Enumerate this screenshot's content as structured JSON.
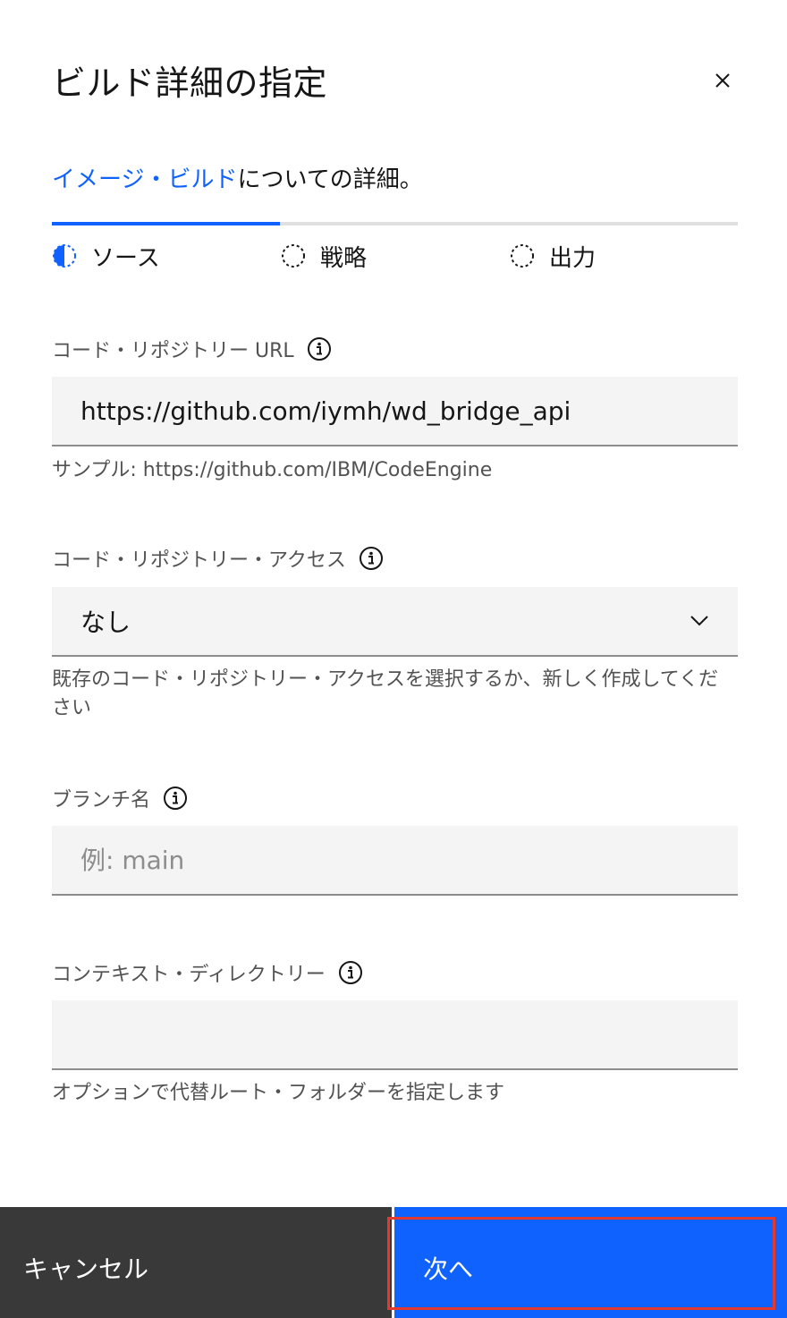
{
  "modal": {
    "title": "ビルド詳細の指定"
  },
  "intro": {
    "link": "イメージ・ビルド",
    "text": "についての詳細。"
  },
  "steps": [
    {
      "label": "ソース",
      "state": "current"
    },
    {
      "label": "戦略",
      "state": "incomplete"
    },
    {
      "label": "出力",
      "state": "incomplete"
    }
  ],
  "repo_url": {
    "label": "コード・リポジトリー URL",
    "value": "https://github.com/iymh/wd_bridge_api",
    "helper": "サンプル: https://github.com/IBM/CodeEngine"
  },
  "repo_access": {
    "label": "コード・リポジトリー・アクセス",
    "selected": "なし",
    "helper": "既存のコード・リポジトリー・アクセスを選択するか、新しく作成してください"
  },
  "branch": {
    "label": "ブランチ名",
    "placeholder": "例: main",
    "value": ""
  },
  "context_dir": {
    "label": "コンテキスト・ディレクトリー",
    "value": "",
    "helper": "オプションで代替ルート・フォルダーを指定します"
  },
  "footer": {
    "cancel_label": "キャンセル",
    "next_label": "次へ"
  },
  "colors": {
    "primary": "#0f62fe",
    "highlight": "#e5392f",
    "secondary_button": "#393939"
  }
}
